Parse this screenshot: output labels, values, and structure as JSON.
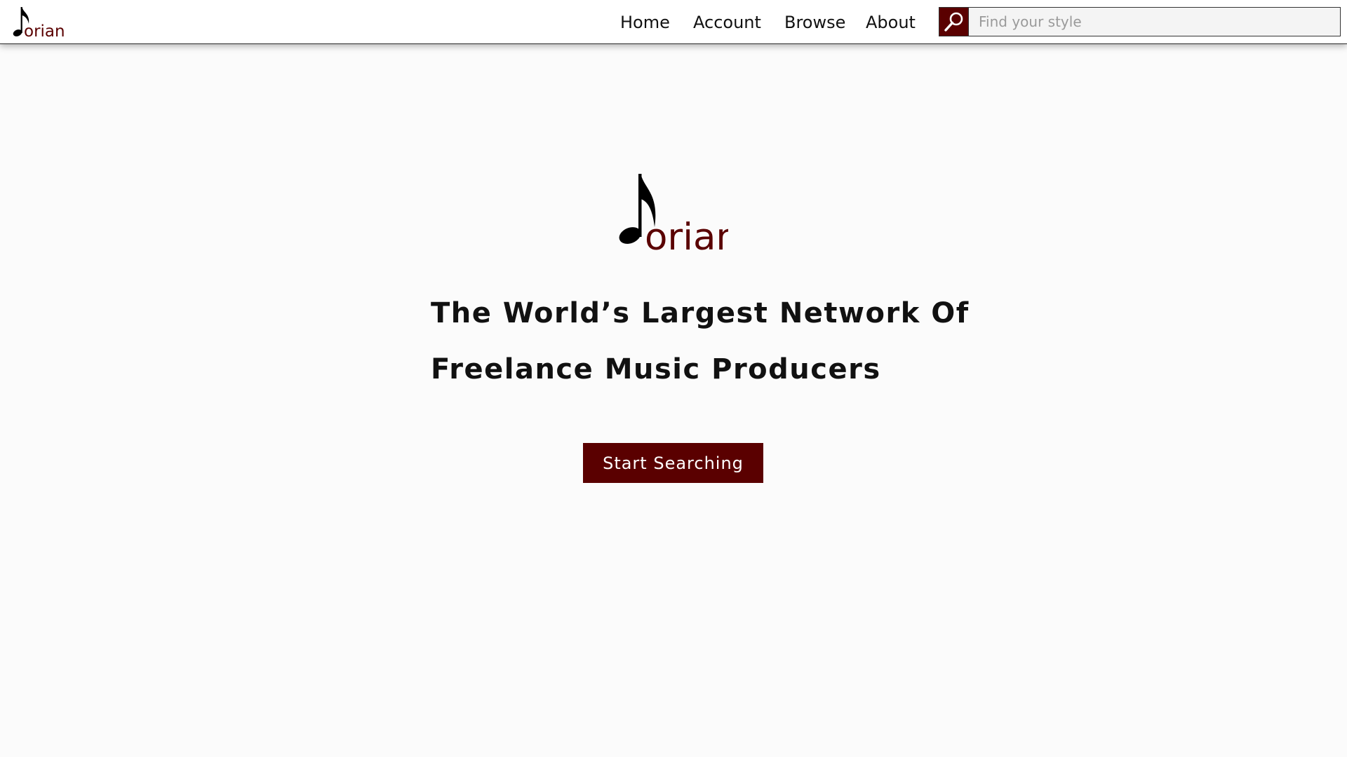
{
  "brand": {
    "logo_text": "orian",
    "accent_color": "#5a0000",
    "logo_icon": "eighth-note-icon"
  },
  "nav": {
    "items": [
      {
        "label": "Home"
      },
      {
        "label": "Account"
      },
      {
        "label": "Browse"
      },
      {
        "label": "About"
      }
    ]
  },
  "search": {
    "placeholder": "Find your style",
    "value": "",
    "icon": "search-icon"
  },
  "hero": {
    "headline_line1": "The World’s Largest Network Of",
    "headline_line2": "Freelance Music Producers",
    "cta_label": "Start Searching"
  }
}
